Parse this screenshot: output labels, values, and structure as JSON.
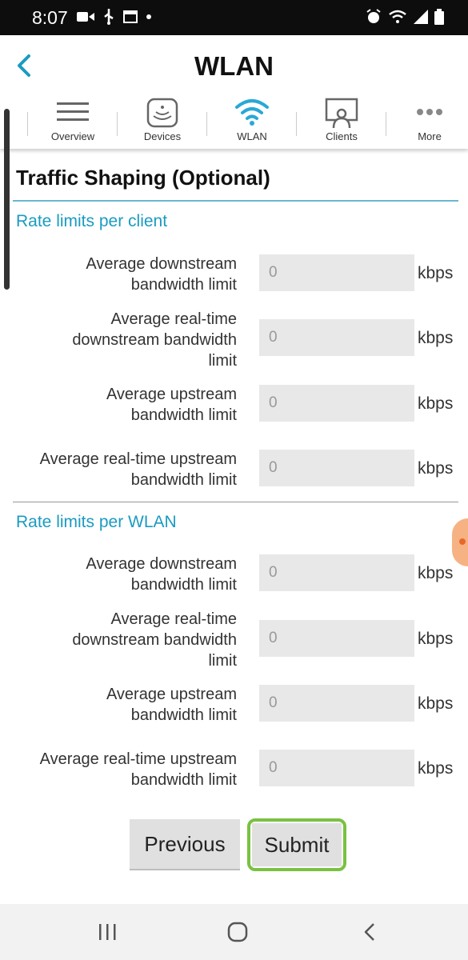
{
  "status_bar": {
    "time": "8:07",
    "left_icons": [
      "video-icon",
      "usb-icon",
      "calendar-icon",
      "dot-icon"
    ],
    "right_icons": [
      "alarm-icon",
      "wifi-icon",
      "signal-icon",
      "battery-icon"
    ]
  },
  "header": {
    "title": "WLAN",
    "back_icon": "chevron-left-icon"
  },
  "tabs": [
    {
      "label": "Overview",
      "icon": "menu-icon"
    },
    {
      "label": "Devices",
      "icon": "device-icon"
    },
    {
      "label": "WLAN",
      "icon": "wifi-icon",
      "active": true
    },
    {
      "label": "Clients",
      "icon": "client-icon"
    },
    {
      "label": "More",
      "icon": "more-icon"
    }
  ],
  "colors": {
    "accent": "#1a9bc0",
    "active_tab": "#29a8d8",
    "submit_highlight": "#7ac143"
  },
  "section": {
    "title": "Traffic Shaping (Optional)",
    "groups": [
      {
        "title": "Rate limits per client",
        "fields": [
          {
            "label_lines": [
              "Average downstream",
              "bandwidth limit"
            ],
            "value": "",
            "placeholder": "0",
            "unit": "kbps"
          },
          {
            "label_lines": [
              "Average real-time",
              "downstream bandwidth",
              "limit"
            ],
            "value": "",
            "placeholder": "0",
            "unit": "kbps"
          },
          {
            "label_lines": [
              "Average upstream",
              "bandwidth limit"
            ],
            "value": "",
            "placeholder": "0",
            "unit": "kbps"
          },
          {
            "label_lines": [
              "Average real-time upstream",
              "bandwidth limit"
            ],
            "value": "",
            "placeholder": "0",
            "unit": "kbps"
          }
        ]
      },
      {
        "title": "Rate limits per WLAN",
        "fields": [
          {
            "label_lines": [
              "Average downstream",
              "bandwidth limit"
            ],
            "value": "",
            "placeholder": "0",
            "unit": "kbps"
          },
          {
            "label_lines": [
              "Average real-time",
              "downstream bandwidth",
              "limit"
            ],
            "value": "",
            "placeholder": "0",
            "unit": "kbps"
          },
          {
            "label_lines": [
              "Average upstream",
              "bandwidth limit"
            ],
            "value": "",
            "placeholder": "0",
            "unit": "kbps"
          },
          {
            "label_lines": [
              "Average real-time upstream",
              "bandwidth limit"
            ],
            "value": "",
            "placeholder": "0",
            "unit": "kbps"
          }
        ]
      }
    ]
  },
  "buttons": {
    "previous": "Previous",
    "submit": "Submit"
  },
  "nav_bar": [
    "recent-apps-icon",
    "home-icon",
    "back-icon"
  ]
}
